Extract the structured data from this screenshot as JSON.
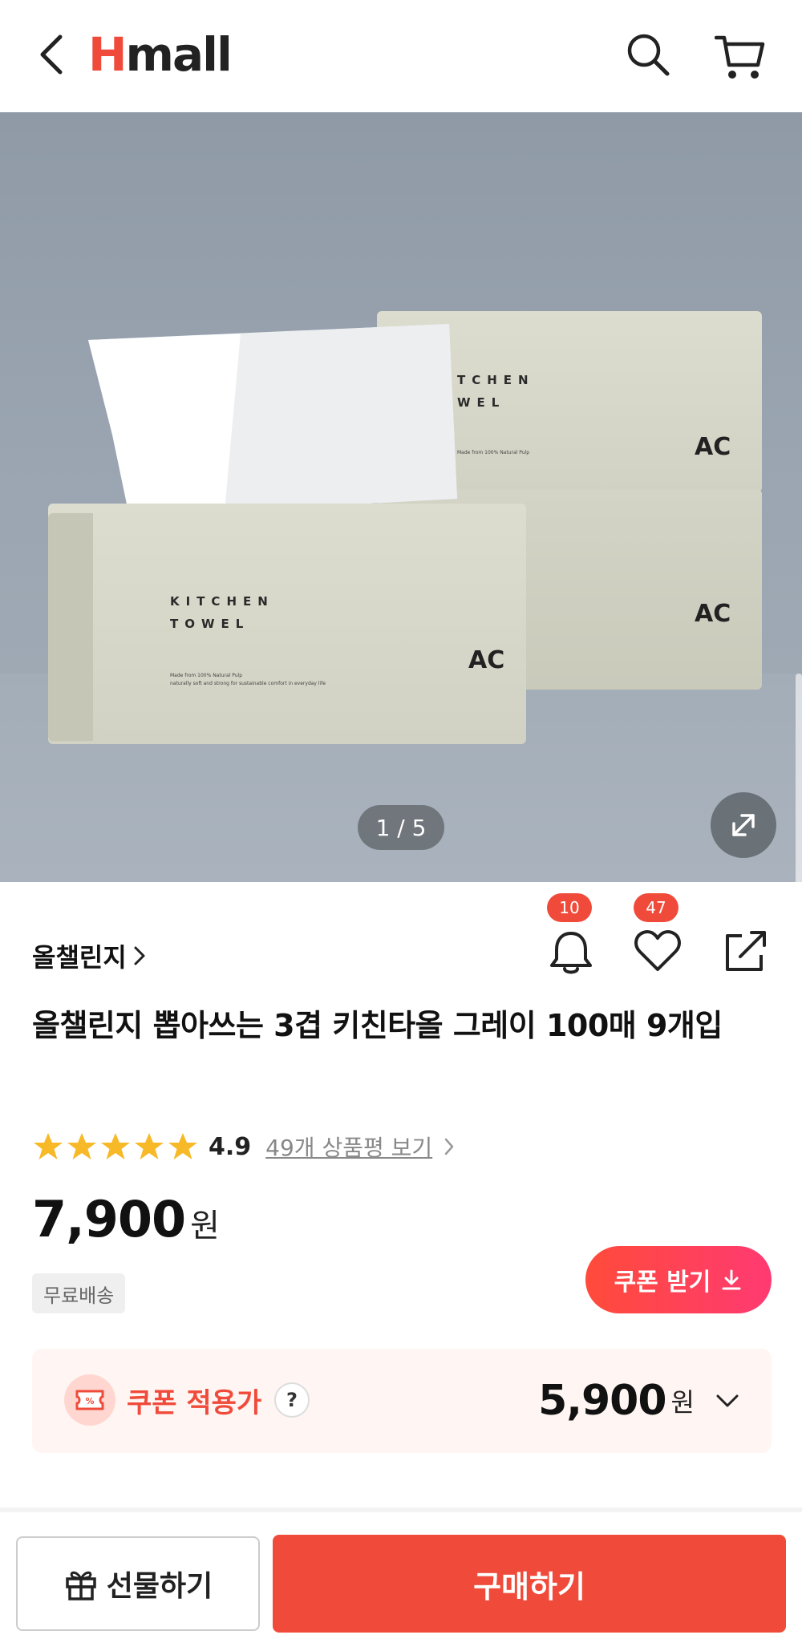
{
  "header": {
    "logo_text_h": "H",
    "logo_text_rest": "mall",
    "back_icon": "chevron-left-icon",
    "search_icon": "search-icon",
    "cart_icon": "cart-icon"
  },
  "hero": {
    "image_indicator": "1 / 5",
    "box_front_line1": "KITCHEN",
    "box_front_line2": "TOWEL",
    "box_back_line1": "TCHEN",
    "box_back_line2": "WEL",
    "box_small_text1": "Made from 100% Natural Pulp",
    "box_small_text2": "naturally soft and strong for sustainable comfort in everyday life",
    "box_logo": "AC"
  },
  "product": {
    "brand": "올챌린지",
    "notify_count": "10",
    "like_count": "47",
    "title": "올챌린지 뽑아쓰는 3겹 키친타올 그레이 100매 9개입",
    "rating": "4.9",
    "rating_stars": 5,
    "review_link": "49개 상품평 보기",
    "price": "7,900",
    "price_unit": "원",
    "shipping": "무료배송",
    "coupon_button": "쿠폰 받기"
  },
  "coupon": {
    "label": "쿠폰 적용가",
    "help": "?",
    "price": "5,900",
    "price_unit": "원"
  },
  "bottom_bar": {
    "gift_label": "선물하기",
    "buy_label": "구매하기"
  },
  "colors": {
    "brand_red": "#f04b3a",
    "coupon_gradient_end": "#ff3a72",
    "star_yellow": "#f7b928",
    "coupon_bg": "#fff5f3"
  }
}
